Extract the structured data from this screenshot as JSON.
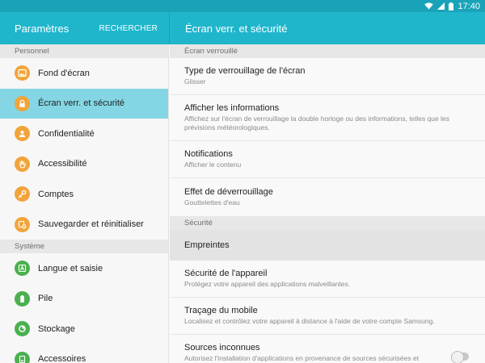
{
  "status_bar": {
    "time": "17:40"
  },
  "left_header": {
    "title": "Paramètres",
    "search": "RECHERCHER"
  },
  "right_header": {
    "title": "Écran verr. et sécurité"
  },
  "left_menu": {
    "personnel_header": "Personnel",
    "personnel_items": [
      {
        "label": "Fond d'écran",
        "icon": "wallpaper-icon"
      },
      {
        "label": "Écran verr. et sécurité",
        "icon": "lock-icon",
        "selected": true
      },
      {
        "label": "Confidentialité",
        "icon": "privacy-icon"
      },
      {
        "label": "Accessibilité",
        "icon": "hand-icon"
      },
      {
        "label": "Comptes",
        "icon": "key-icon"
      },
      {
        "label": "Sauvegarder et réinitialiser",
        "icon": "backup-icon"
      }
    ],
    "systeme_header": "Système",
    "systeme_items": [
      {
        "label": "Langue et saisie",
        "icon": "language-icon"
      },
      {
        "label": "Pile",
        "icon": "battery-icon"
      },
      {
        "label": "Stockage",
        "icon": "storage-icon"
      },
      {
        "label": "Accessoires",
        "icon": "accessories-icon"
      }
    ]
  },
  "right_content": {
    "lock_section_header": "Écran verrouillé",
    "lock_items": [
      {
        "title": "Type de verrouillage de l'écran",
        "subtitle": "Glisser"
      },
      {
        "title": "Afficher les informations",
        "subtitle": "Affichez sur l'écran de verrouillage la double horloge ou des informations, telles que les prévisions météorologiques."
      },
      {
        "title": "Notifications",
        "subtitle": "Afficher le contenu"
      },
      {
        "title": "Effet de déverrouillage",
        "subtitle": "Gouttelettes d'eau"
      }
    ],
    "security_section_header": "Sécurité",
    "security_items": [
      {
        "title": "Empreintes",
        "subtitle": ""
      },
      {
        "title": "Sécurité de l'appareil",
        "subtitle": "Protégez votre appareil des applications malveillantes."
      },
      {
        "title": "Traçage du mobile",
        "subtitle": "Localisez et contrôlez votre appareil à distance à l'aide de votre compte Samsung."
      },
      {
        "title": "Sources inconnues",
        "subtitle": "Autorisez l'installation d'applications en provenance de sources sécurisées et",
        "toggle_on": false
      }
    ]
  },
  "colors": {
    "header": "#1fb6cc",
    "status_bar": "#1aa3b8",
    "selected": "#84d6e4",
    "icon_orange": "#f2a43a",
    "icon_green": "#4bb04f"
  }
}
